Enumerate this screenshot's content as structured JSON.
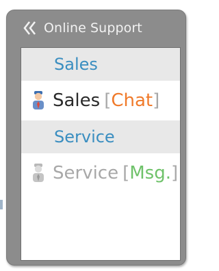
{
  "widget": {
    "title": "Online Support",
    "collapse_icon": "double-chevron-left-icon"
  },
  "groups": [
    {
      "title": "Sales",
      "agent": {
        "name": "Sales",
        "action": "Chat",
        "status": "online",
        "icon": "agent-online-icon"
      }
    },
    {
      "title": "Service",
      "agent": {
        "name": "Service",
        "action": "Msg.",
        "status": "offline",
        "icon": "agent-offline-icon"
      }
    }
  ],
  "colors": {
    "frame": "#8c8c8c",
    "group_title": "#3a8ec0",
    "chat_action": "#f07a2a",
    "message_action": "#6fc26a",
    "offline_text": "#a8a8a8"
  }
}
